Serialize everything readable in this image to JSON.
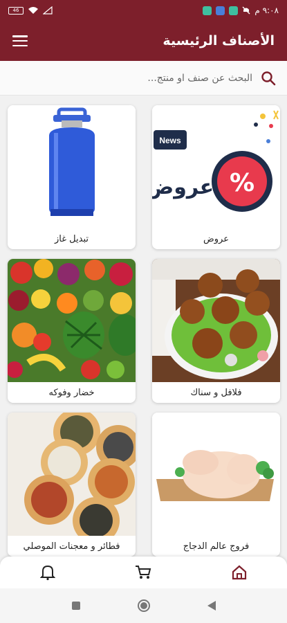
{
  "status_bar": {
    "time": "٩:٠٨ م",
    "battery": "46"
  },
  "app_bar": {
    "title": "الأصناف الرئيسية"
  },
  "search": {
    "placeholder": "البحث عن صنف او منتج..."
  },
  "categories": [
    {
      "label": "عروض",
      "image": "offers-news-badge-image"
    },
    {
      "label": "تبديل غاز",
      "image": "gas-cylinder-image"
    },
    {
      "label": "فلافل و سناك",
      "image": "falafel-image"
    },
    {
      "label": "خضار وفوكه",
      "image": "fruits-vegetables-image"
    },
    {
      "label": "فروج عالم الدجاج",
      "image": "raw-chicken-image"
    },
    {
      "label": "فطائر و معجنات الموصلي",
      "image": "pastries-image"
    }
  ],
  "card_images": {
    "offers_badge": "News",
    "offers_word": "عروض",
    "offers_percent": "%"
  },
  "bottom_nav": {
    "items": [
      "home-icon",
      "cart-icon",
      "bell-icon"
    ]
  },
  "colors": {
    "primary": "#7d1f2b",
    "accent_red": "#e83a4d",
    "offer_navy": "#1f2d4a"
  }
}
